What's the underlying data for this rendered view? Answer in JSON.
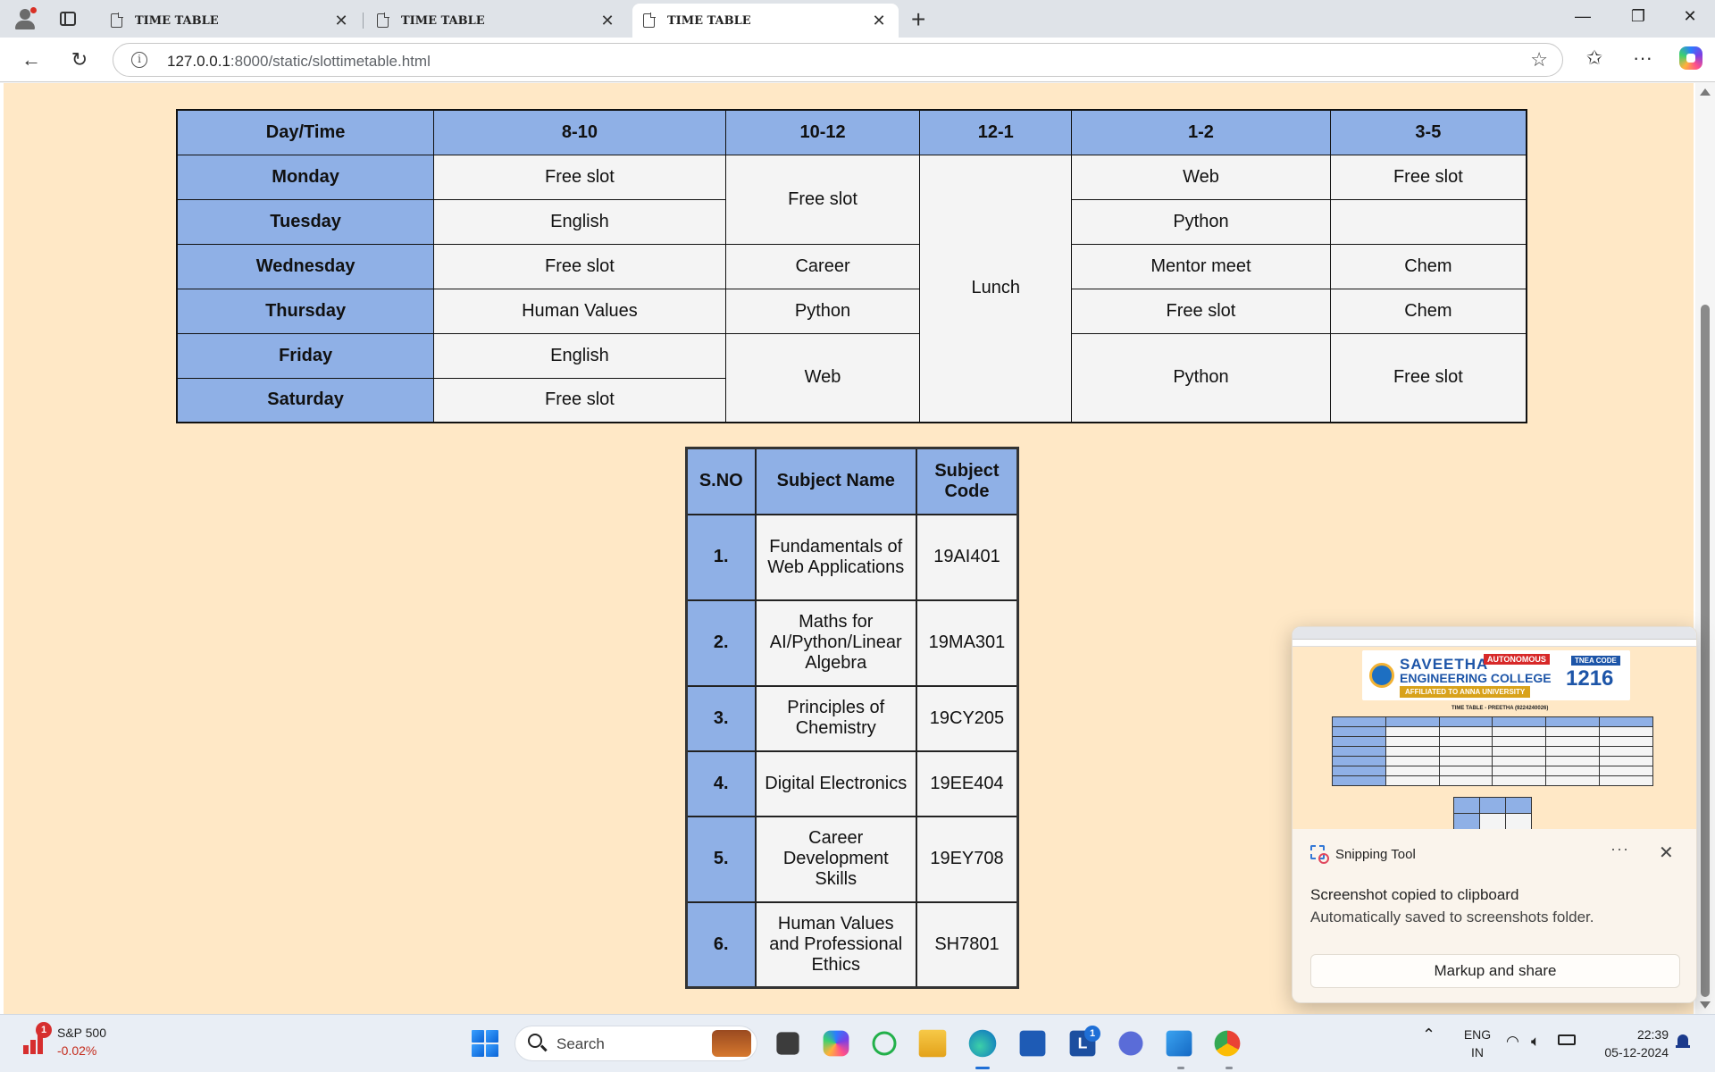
{
  "browser": {
    "tabs": [
      {
        "title": "TIME TABLE",
        "active": false
      },
      {
        "title": "TIME TABLE",
        "active": false
      },
      {
        "title": "TIME TABLE",
        "active": true
      }
    ],
    "url_host": "127.0.0.1",
    "url_rest": ":8000/static/slottimetable.html"
  },
  "page": {
    "timetable": {
      "headers": [
        "Day/Time",
        "8-10",
        "10-12",
        "12-1",
        "1-2",
        "3-5"
      ],
      "days": [
        "Monday",
        "Tuesday",
        "Wednesday",
        "Thursday",
        "Friday",
        "Saturday"
      ],
      "slot_8_10": [
        "Free slot",
        "English",
        "Free slot",
        "Human Values",
        "English",
        "Free slot"
      ],
      "slot_10_12": {
        "mon_tue": "Free slot",
        "wed": "Career",
        "thu": "Python",
        "fri_sat": "Web"
      },
      "slot_12_1": "Lunch",
      "slot_1_2": {
        "mon": "Web",
        "tue": "Python",
        "wed": "Mentor meet",
        "thu": "Free slot",
        "fri_sat": "Python"
      },
      "slot_3_5": {
        "mon": "Free slot",
        "tue": "",
        "wed": "Chem",
        "thu": "Chem",
        "fri_sat": "Free slot"
      }
    },
    "subjects": {
      "headers": [
        "S.NO",
        "Subject Name",
        "Subject Code"
      ],
      "rows": [
        {
          "sno": "1.",
          "name": "Fundamentals of Web Applications",
          "code": "19AI401"
        },
        {
          "sno": "2.",
          "name": "Maths for AI/Python/Linear Algebra",
          "code": "19MA301"
        },
        {
          "sno": "3.",
          "name": "Principles of Chemistry",
          "code": "19CY205"
        },
        {
          "sno": "4.",
          "name": "Digital Electronics",
          "code": "19EE404"
        },
        {
          "sno": "5.",
          "name": "Career Development Skills",
          "code": "19EY708"
        },
        {
          "sno": "6.",
          "name": "Human Values and Professional Ethics",
          "code": "SH7801"
        }
      ]
    }
  },
  "toast": {
    "app_name": "Snipping Tool",
    "title": "Screenshot copied to clipboard",
    "subtitle": "Automatically saved to screenshots folder.",
    "button": "Markup and share",
    "preview": {
      "college_line1": "SAVEETHA",
      "college_line2": "ENGINEERING COLLEGE",
      "autonomous": "AUTONOMOUS",
      "affiliation": "AFFILIATED TO ANNA UNIVERSITY",
      "tnea_label": "TNEA CODE",
      "tnea_code": "1216",
      "page_title": "TIME TABLE - PREETHA (9224240026)"
    }
  },
  "taskbar": {
    "stock_name": "S&P 500",
    "stock_change": "-0.02%",
    "stock_badge": "1",
    "search_label": "Search",
    "lang_line1": "ENG",
    "lang_line2": "IN",
    "time": "22:39",
    "date": "05-12-2024",
    "app_badge": "1"
  }
}
